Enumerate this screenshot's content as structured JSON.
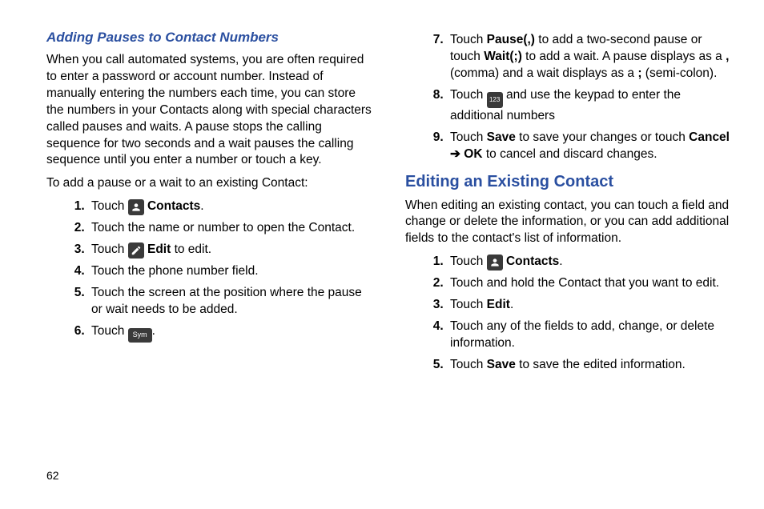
{
  "left": {
    "heading": "Adding Pauses to Contact Numbers",
    "intro": "When you call automated systems, you are often required to enter a password or account number. Instead of manually entering the numbers each time, you can store the numbers in your Contacts along with special characters called pauses and waits. A pause stops the calling sequence for two seconds and a wait pauses the calling sequence until you enter a number or touch a key.",
    "lead": "To add a pause or a wait to an existing Contact:",
    "steps": {
      "s1_touch": "Touch ",
      "s1_contacts": " Contacts",
      "s1_end": ".",
      "s2": "Touch the name or number to open the Contact.",
      "s3_touch": "Touch ",
      "s3_edit": " Edit",
      "s3_end": " to edit.",
      "s4": "Touch the phone number field.",
      "s5": "Touch the screen at the position where the pause or wait needs to be added.",
      "s6_touch": "Touch ",
      "s6_end": "."
    }
  },
  "right": {
    "steps": {
      "s7_a": "Touch ",
      "s7_pause": "Pause(,)",
      "s7_b": " to add a two-second pause or touch ",
      "s7_wait": "Wait(;)",
      "s7_c": " to add a wait. A pause displays as a ",
      "s7_comma": ",",
      "s7_d": " (comma) and a wait displays as a ",
      "s7_semi": ";",
      "s7_e": " (semi-colon).",
      "s8_a": "Touch ",
      "s8_b": " and use the keypad to enter the additional numbers",
      "s9_a": "Touch ",
      "s9_save": "Save",
      "s9_b": " to save your changes or touch ",
      "s9_cancel": "Cancel",
      "s9_arrow": " ➔ ",
      "s9_ok": "OK",
      "s9_c": " to cancel and discard changes."
    },
    "heading2": "Editing an Existing Contact",
    "intro2": "When editing an existing contact, you can touch a field and change or delete the information, or you can add additional fields to the contact's list of information.",
    "steps2": {
      "s1_touch": "Touch ",
      "s1_contacts": " Contacts",
      "s1_end": ".",
      "s2": "Touch and hold the Contact that you want to edit.",
      "s3_a": "Touch ",
      "s3_edit": "Edit",
      "s3_b": ".",
      "s4": "Touch any of the fields to add, change, or delete information.",
      "s5_a": "Touch ",
      "s5_save": "Save",
      "s5_b": " to save the edited information."
    }
  },
  "icons": {
    "sym_label": "Sym",
    "num_label": "123"
  },
  "page_number": "62"
}
